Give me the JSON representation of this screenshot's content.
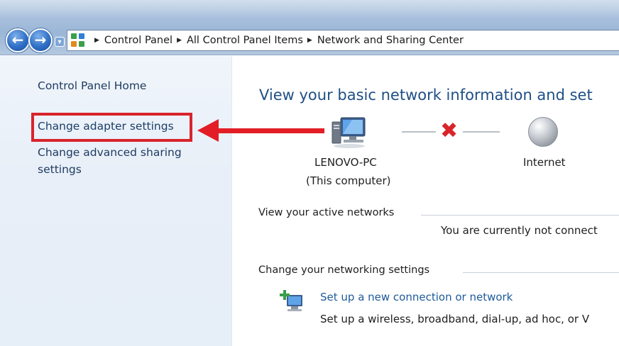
{
  "breadcrumb": {
    "items": [
      "Control Panel",
      "All Control Panel Items",
      "Network and Sharing Center"
    ]
  },
  "sidebar": {
    "home": "Control Panel Home",
    "adapter": "Change adapter settings",
    "advanced_line1": "Change advanced sharing",
    "advanced_line2": "settings"
  },
  "main": {
    "title": "View your basic network information and set",
    "computer_name": "LENOVO-PC",
    "computer_sub": "(This computer)",
    "internet": "Internet",
    "active_networks": "View your active networks",
    "not_connected": "You are currently not connect",
    "change_settings": "Change your networking settings",
    "setup_link": "Set up a new connection or network",
    "setup_desc": "Set up a wireless, broadband, dial-up, ad hoc, or V"
  },
  "colors": {
    "highlight": "#d9242b",
    "link": "#1e5a9a",
    "title": "#1e4f86"
  },
  "icons": [
    "back-icon",
    "forward-icon",
    "control-panel-icon",
    "computer-icon",
    "x-icon",
    "globe-icon",
    "network-setup-icon"
  ]
}
